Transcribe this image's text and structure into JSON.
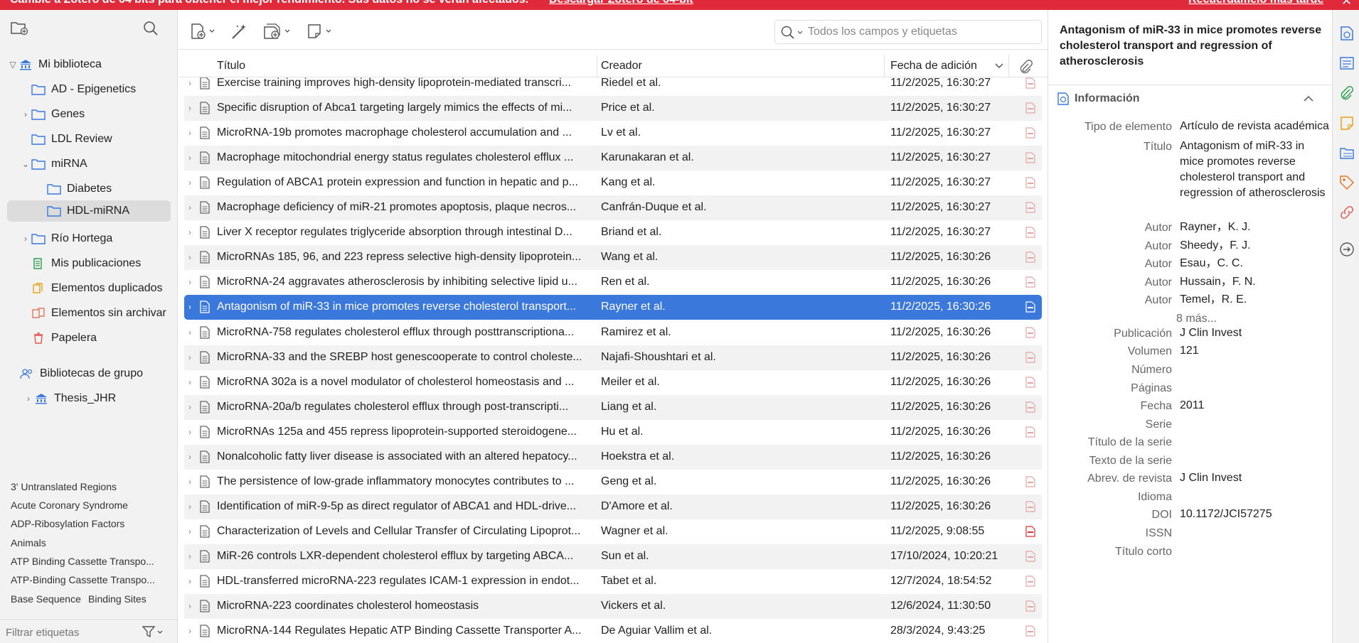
{
  "banner": {
    "message": "Cambie a Zotero de 64 bits para obtener el mejor rendimiento. Sus datos no se verán afectados.",
    "download": "Descargar Zotero de 64-bit",
    "later": "Recuérdamelo más tarde",
    "close": "✕"
  },
  "collections": {
    "my_library": "Mi biblioteca",
    "items": [
      {
        "label": "AD - Epigenetics"
      },
      {
        "label": "Genes"
      },
      {
        "label": "LDL Review"
      },
      {
        "label": "miRNA"
      },
      {
        "label": "Diabetes"
      },
      {
        "label": "HDL-miRNA"
      },
      {
        "label": "Río Hortega"
      },
      {
        "label": "Mis publicaciones"
      },
      {
        "label": "Elementos duplicados"
      },
      {
        "label": "Elementos sin archivar"
      },
      {
        "label": "Papelera"
      }
    ],
    "group_libraries": "Bibliotecas de grupo",
    "thesis": "Thesis_JHR"
  },
  "tags": [
    "3' Untranslated Regions",
    "Acute Coronary Syndrome",
    "ADP-Ribosylation Factors",
    "Animals",
    "ATP Binding Cassette Transpo...",
    "ATP-Binding Cassette Transpo...",
    "Base Sequence",
    "Binding Sites"
  ],
  "tag_filter": {
    "placeholder": "Filtrar etiquetas"
  },
  "search": {
    "placeholder": "Todos los campos y etiquetas"
  },
  "columns": {
    "title": "Título",
    "creator": "Creador",
    "date": "Fecha de adición"
  },
  "items": [
    {
      "title": "Exercise training improves high-density lipoprotein-mediated transcri...",
      "creator": "Riedel et al.",
      "date": "11/2/2025, 16:30:27"
    },
    {
      "title": "Specific disruption of Abca1 targeting largely mimics the effects of mi...",
      "creator": "Price et al.",
      "date": "11/2/2025, 16:30:27"
    },
    {
      "title": "MicroRNA-19b promotes macrophage cholesterol accumulation and ...",
      "creator": "Lv et al.",
      "date": "11/2/2025, 16:30:27"
    },
    {
      "title": "Macrophage mitochondrial energy status regulates cholesterol efflux ...",
      "creator": "Karunakaran et al.",
      "date": "11/2/2025, 16:30:27"
    },
    {
      "title": "Regulation of ABCA1 protein expression and function in hepatic and p...",
      "creator": "Kang et al.",
      "date": "11/2/2025, 16:30:27"
    },
    {
      "title": "Macrophage deficiency of miR-21 promotes apoptosis, plaque necros...",
      "creator": "Canfrán-Duque et al.",
      "date": "11/2/2025, 16:30:27"
    },
    {
      "title": "Liver X receptor regulates triglyceride absorption through intestinal D...",
      "creator": "Briand et al.",
      "date": "11/2/2025, 16:30:27"
    },
    {
      "title": "MicroRNAs 185, 96, and 223 repress selective high-density lipoprotein...",
      "creator": "Wang et al.",
      "date": "11/2/2025, 16:30:26"
    },
    {
      "title": "MicroRNA-24 aggravates atherosclerosis by inhibiting selective lipid u...",
      "creator": "Ren et al.",
      "date": "11/2/2025, 16:30:26"
    },
    {
      "title": "Antagonism of miR-33 in mice promotes reverse cholesterol transport...",
      "creator": "Rayner et al.",
      "date": "11/2/2025, 16:30:26"
    },
    {
      "title": "MicroRNA-758 regulates cholesterol efflux through posttranscriptiona...",
      "creator": "Ramirez et al.",
      "date": "11/2/2025, 16:30:26"
    },
    {
      "title": "MicroRNA-33 and the SREBP host genescooperate to control choleste...",
      "creator": "Najafi-Shoushtari et al.",
      "date": "11/2/2025, 16:30:26"
    },
    {
      "title": "MicroRNA 302a is a novel modulator of cholesterol homeostasis and ...",
      "creator": "Meiler et al.",
      "date": "11/2/2025, 16:30:26"
    },
    {
      "title": "MicroRNA-20a/b regulates cholesterol efflux through post-transcripti...",
      "creator": "Liang et al.",
      "date": "11/2/2025, 16:30:26"
    },
    {
      "title": "MicroRNAs 125a and 455 repress lipoprotein-supported steroidogene...",
      "creator": "Hu et al.",
      "date": "11/2/2025, 16:30:26"
    },
    {
      "title": "Nonalcoholic fatty liver disease is associated with an altered hepatocy...",
      "creator": "Hoekstra et al.",
      "date": "11/2/2025, 16:30:26"
    },
    {
      "title": "The persistence of low-grade inflammatory monocytes contributes to ...",
      "creator": "Geng et al.",
      "date": "11/2/2025, 16:30:26"
    },
    {
      "title": "Identification of miR-9-5p as direct regulator of ABCA1 and HDL-drive...",
      "creator": "D'Amore et al.",
      "date": "11/2/2025, 16:30:26"
    },
    {
      "title": "Characterization of Levels and Cellular Transfer of Circulating Lipoprot...",
      "creator": "Wagner et al.",
      "date": "11/2/2025, 9:08:55"
    },
    {
      "title": "MiR-26 controls LXR-dependent cholesterol efflux by targeting ABCA...",
      "creator": "Sun et al.",
      "date": "17/10/2024, 10:20:21"
    },
    {
      "title": "HDL-transferred microRNA-223 regulates ICAM-1 expression in endot...",
      "creator": "Tabet et al.",
      "date": "12/7/2024, 18:54:52"
    },
    {
      "title": "MicroRNA-223 coordinates cholesterol homeostasis",
      "creator": "Vickers et al.",
      "date": "12/6/2024, 11:30:50"
    },
    {
      "title": "MicroRNA-144 Regulates Hepatic ATP Binding Cassette Transporter A...",
      "creator": "De Aguiar Vallim et al.",
      "date": "28/3/2024, 9:43:25"
    }
  ],
  "detail": {
    "header": "Antagonism of miR-33 in mice promotes reverse cholesterol transport and regression of atherosclerosis",
    "section": "Información",
    "fields": {
      "item_type_label": "Tipo de elemento",
      "item_type": "Artículo de revista académica",
      "title_label": "Título",
      "title": "Antagonism of miR-33 in mice promotes reverse cholesterol transport and regression of atherosclerosis",
      "author_label": "Autor",
      "authors": [
        "Rayner，K. J.",
        "Sheedy，F. J.",
        "Esau，C. C.",
        "Hussain，F. N.",
        "Temel，R. E."
      ],
      "more": "8 más...",
      "publication_label": "Publicación",
      "publication": "J Clin Invest",
      "volume_label": "Volumen",
      "volume": "121",
      "number_label": "Número",
      "pages_label": "Páginas",
      "date_label": "Fecha",
      "date": "2011",
      "series_label": "Serie",
      "series_title_label": "Título de la serie",
      "series_text_label": "Texto de la serie",
      "journal_abbr_label": "Abrev. de revista",
      "journal_abbr": "J Clin Invest",
      "language_label": "Idioma",
      "doi_label": "DOI",
      "doi": "10.1172/JCI57275",
      "issn_label": "ISSN",
      "short_title_label": "Título corto"
    }
  },
  "colors": {
    "banner": "#e0293b",
    "selection": "#3b78dc",
    "accent": "#3b78dc"
  }
}
